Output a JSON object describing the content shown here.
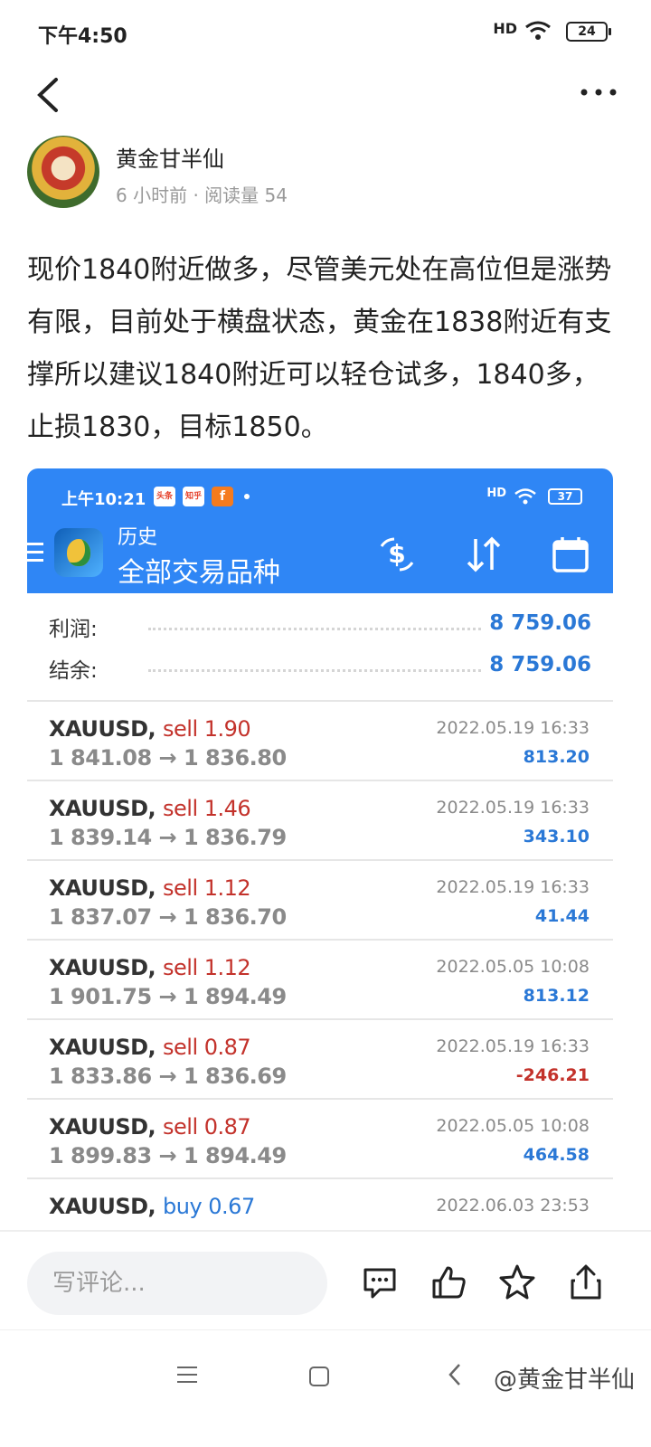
{
  "status_bar": {
    "time": "下午4:50",
    "signal": "HD",
    "battery": "24"
  },
  "nav": {
    "back_icon": "chevron-left-icon",
    "more_icon": "more-horizontal-icon"
  },
  "author": {
    "name": "黄金甘半仙",
    "meta": "6 小时前 · 阅读量 54"
  },
  "post": {
    "text": "现价1840附近做多，尽管美元处在高位但是涨势有限，目前处于横盘状态，黄金在1838附近有支撑所以建议1840附近可以轻仓试多，1840多，止损1830，目标1850。"
  },
  "screenshot": {
    "status_time": "上午10:21",
    "badges": [
      "头条",
      "知乎",
      "f"
    ],
    "signal": "HD",
    "battery": "37",
    "title1": "历史",
    "title2": "全部交易品种",
    "summary": [
      {
        "label": "利润:",
        "value": "8 759.06"
      },
      {
        "label": "结余:",
        "value": "8 759.06"
      }
    ],
    "trades": [
      {
        "symbol": "XAUUSD,",
        "side": "sell 1.90",
        "side_type": "sell",
        "prices": "1 841.08 → 1 836.80",
        "date": "2022.05.19 16:33",
        "profit": "813.20",
        "neg": false
      },
      {
        "symbol": "XAUUSD,",
        "side": "sell 1.46",
        "side_type": "sell",
        "prices": "1 839.14 → 1 836.79",
        "date": "2022.05.19 16:33",
        "profit": "343.10",
        "neg": false
      },
      {
        "symbol": "XAUUSD,",
        "side": "sell 1.12",
        "side_type": "sell",
        "prices": "1 837.07 → 1 836.70",
        "date": "2022.05.19 16:33",
        "profit": "41.44",
        "neg": false
      },
      {
        "symbol": "XAUUSD,",
        "side": "sell 1.12",
        "side_type": "sell",
        "prices": "1 901.75 → 1 894.49",
        "date": "2022.05.05 10:08",
        "profit": "813.12",
        "neg": false
      },
      {
        "symbol": "XAUUSD,",
        "side": "sell 0.87",
        "side_type": "sell",
        "prices": "1 833.86 → 1 836.69",
        "date": "2022.05.19 16:33",
        "profit": "-246.21",
        "neg": true
      },
      {
        "symbol": "XAUUSD,",
        "side": "sell 0.87",
        "side_type": "sell",
        "prices": "1 899.83 → 1 894.49",
        "date": "2022.05.05 10:08",
        "profit": "464.58",
        "neg": false
      },
      {
        "symbol": "XAUUSD,",
        "side": "buy 0.67",
        "side_type": "buy",
        "prices": "",
        "date": "2022.06.03 23:53",
        "profit": "",
        "neg": false
      }
    ]
  },
  "comment_bar": {
    "placeholder": "写评论...",
    "icons": [
      "comment-icon",
      "like-icon",
      "star-icon",
      "share-icon"
    ]
  },
  "system_nav": {
    "watermark": "@黄金甘半仙"
  },
  "colors": {
    "mt_blue": "#2f86f5",
    "profit_blue": "#2a78d6",
    "loss_red": "#c3322b"
  }
}
